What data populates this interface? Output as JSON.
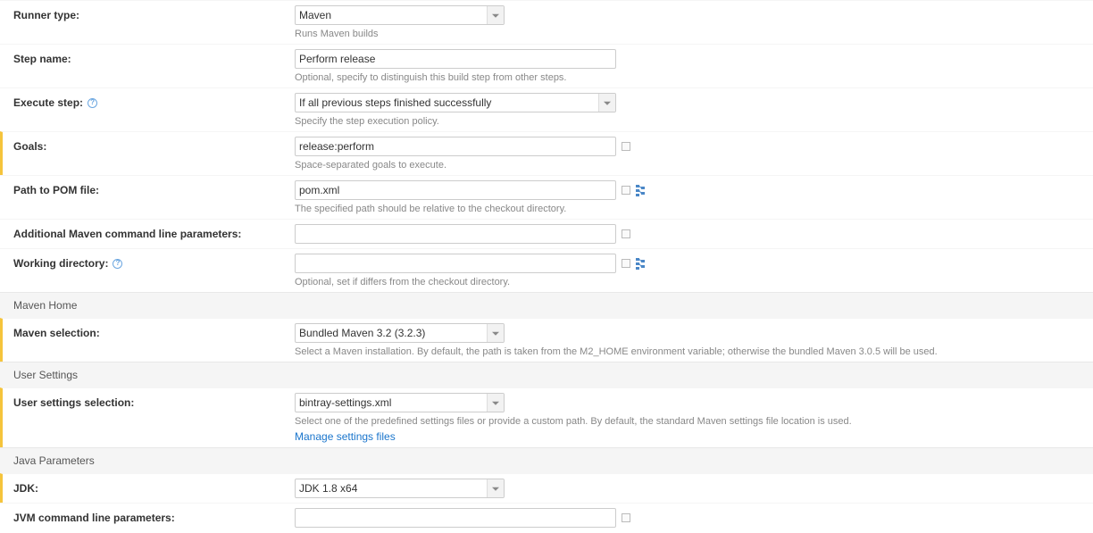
{
  "runnerType": {
    "label": "Runner type:",
    "value": "Maven",
    "hint": "Runs Maven builds"
  },
  "stepName": {
    "label": "Step name:",
    "value": "Perform release",
    "hint": "Optional, specify to distinguish this build step from other steps."
  },
  "executeStep": {
    "label": "Execute step:",
    "value": "If all previous steps finished successfully",
    "hint": "Specify the step execution policy."
  },
  "goals": {
    "label": "Goals:",
    "value": "release:perform",
    "hint": "Space-separated goals to execute."
  },
  "pomPath": {
    "label": "Path to POM file:",
    "value": "pom.xml",
    "hint": "The specified path should be relative to the checkout directory."
  },
  "additionalParams": {
    "label": "Additional Maven command line parameters:",
    "value": ""
  },
  "workingDir": {
    "label": "Working directory:",
    "value": "",
    "hint": "Optional, set if differs from the checkout directory."
  },
  "sections": {
    "mavenHome": "Maven Home",
    "userSettings": "User Settings",
    "javaParams": "Java Parameters"
  },
  "mavenSelection": {
    "label": "Maven selection:",
    "value": "Bundled Maven 3.2 (3.2.3)",
    "hint": "Select a Maven installation. By default, the path is taken from the M2_HOME environment variable; otherwise the bundled Maven 3.0.5 will be used."
  },
  "userSettingsSelection": {
    "label": "User settings selection:",
    "value": "bintray-settings.xml",
    "hint": "Select one of the predefined settings files or provide a custom path. By default, the standard Maven settings file location is used.",
    "link": "Manage settings files"
  },
  "jdk": {
    "label": "JDK:",
    "value": "JDK 1.8 x64"
  },
  "jvmParams": {
    "label": "JVM command line parameters:",
    "value": ""
  }
}
